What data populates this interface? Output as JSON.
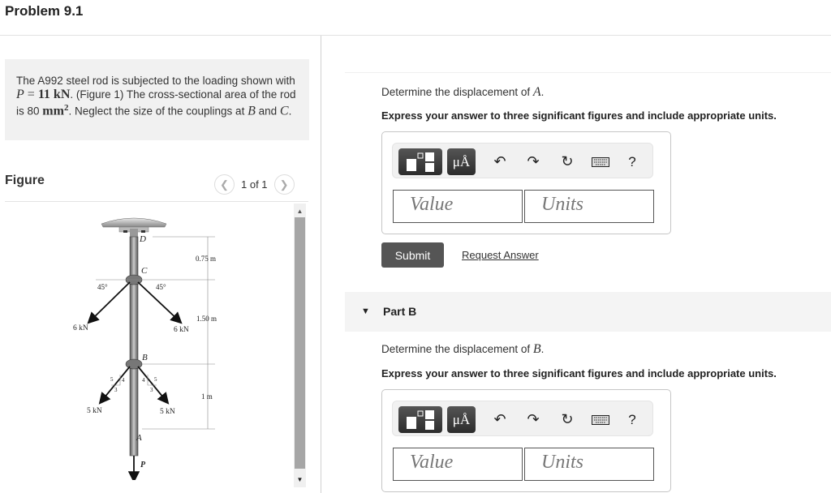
{
  "page": {
    "title": "Problem 9.1"
  },
  "problem": {
    "text_1": "The A992 steel rod is subjected to the loading shown with ",
    "p_var": "P",
    "p_eq": " = ",
    "p_val": "11 kN",
    "text_2": ". (Figure 1) The cross-sectional area of the rod is 80 ",
    "area_unit": "mm",
    "area_exp": "2",
    "text_3": ". Neglect the size of the couplings at ",
    "b_var": "B",
    "text_4": " and ",
    "c_var": "C",
    "text_5": "."
  },
  "figure": {
    "label": "Figure",
    "pager": "1 of 1",
    "prev_icon": "chevron-left-icon",
    "next_icon": "chevron-right-icon",
    "diagram": {
      "points": {
        "D": "D",
        "C": "C",
        "B": "B",
        "A": "A",
        "P": "P"
      },
      "angle_left": "45°",
      "angle_right": "45°",
      "force_c_left": "6 kN",
      "force_c_right": "6 kN",
      "force_b_left": "5 kN",
      "force_b_right": "5 kN",
      "slope_5": "5",
      "slope_4": "4",
      "slope_3": "3",
      "dim_dc": "0.75 m",
      "dim_cb": "1.50 m",
      "dim_ba": "1 m"
    }
  },
  "part_a": {
    "prompt_text": "Determine the displacement of ",
    "prompt_var": "A",
    "prompt_end": ".",
    "instruction": "Express your answer to three significant figures and include appropriate units.",
    "value_placeholder": "Value",
    "units_placeholder": "Units",
    "submit_label": "Submit",
    "request_label": "Request Answer"
  },
  "part_b": {
    "header": "Part B",
    "prompt_text": "Determine the displacement of ",
    "prompt_var": "B",
    "prompt_end": ".",
    "instruction": "Express your answer to three significant figures and include appropriate units.",
    "value_placeholder": "Value",
    "units_placeholder": "Units"
  },
  "toolbar": {
    "units_symbol": "μÅ",
    "help_symbol": "?",
    "undo_icon": "↶",
    "redo_icon": "↷",
    "reset_icon": "↻"
  }
}
